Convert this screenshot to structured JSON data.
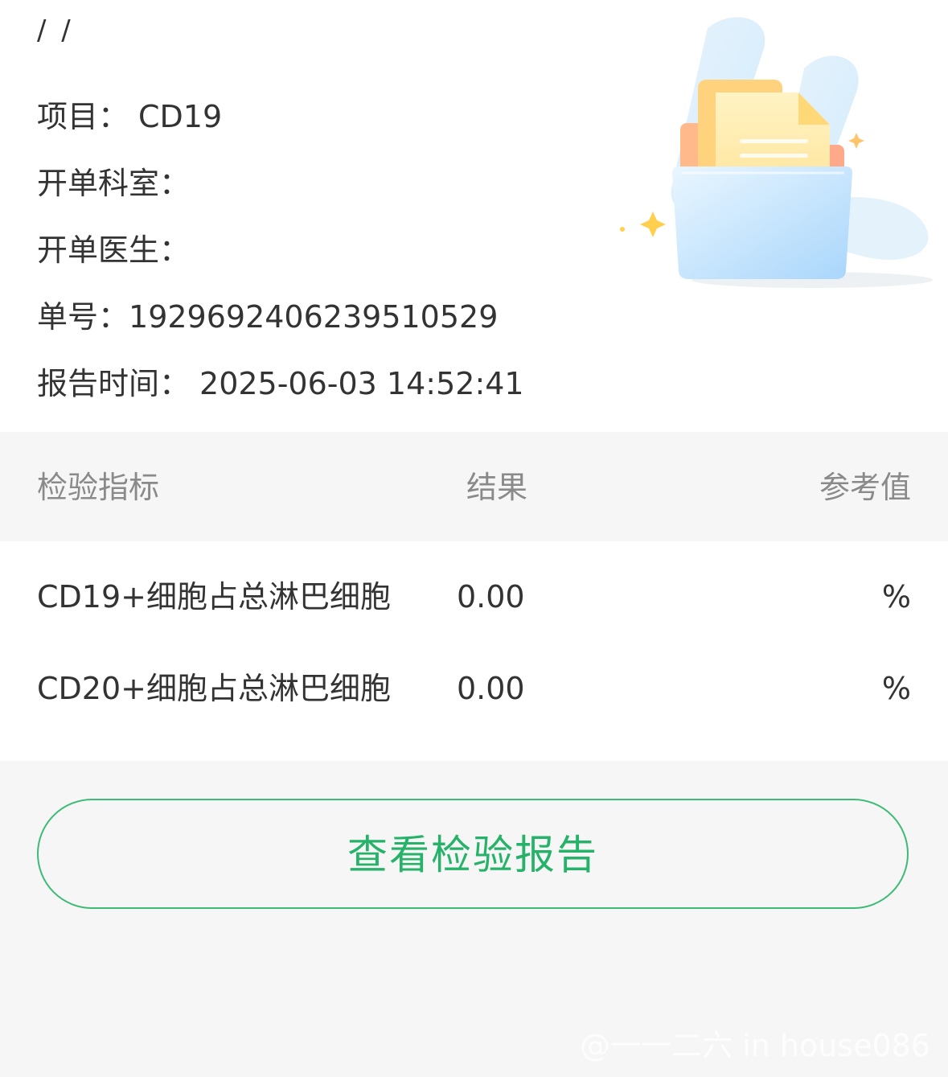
{
  "header": {
    "breadcrumb": "/ /"
  },
  "info": {
    "item_label": "项目：",
    "item_value": "CD19",
    "dept_label": "开单科室：",
    "dept_value": "",
    "doctor_label": "开单医生：",
    "doctor_value": "",
    "order_label": "单号：",
    "order_value": "1929692406239510529",
    "time_label": "报告时间：",
    "time_value": "2025-06-03 14:52:41"
  },
  "table": {
    "headers": {
      "name": "检验指标",
      "result": "结果",
      "reference": "参考值"
    },
    "rows": [
      {
        "name": "CD19+细胞占总淋巴细胞",
        "result": "0.00",
        "reference": "%"
      },
      {
        "name": "CD20+细胞占总淋巴细胞",
        "result": "0.00",
        "reference": "%"
      }
    ]
  },
  "actions": {
    "view_report_label": "查看检验报告"
  },
  "watermark": "@一一二六 in house086",
  "colors": {
    "accent_green": "#27b26a",
    "text": "#333333",
    "muted": "#8a8a8a",
    "background": "#f6f6f6"
  }
}
